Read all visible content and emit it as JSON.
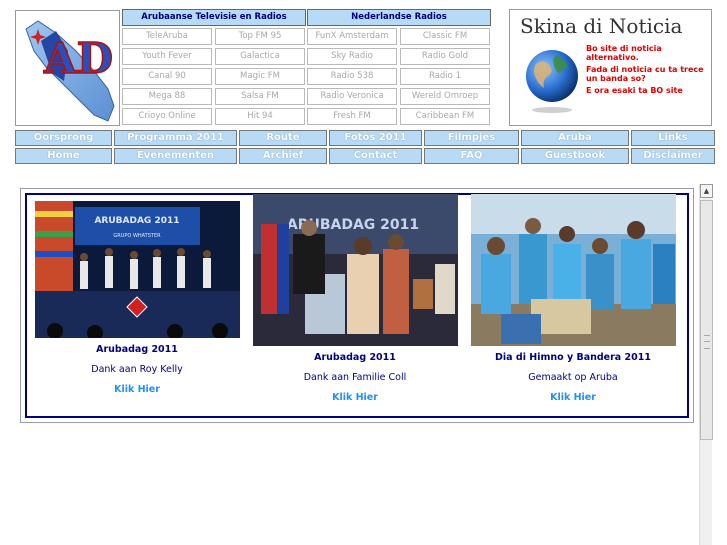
{
  "logo": {
    "text": "AD"
  },
  "radio": {
    "left_header": "Arubaanse Televisie en Radios",
    "right_header": "Nederlandse Radios",
    "left_items": [
      "TeleAruba",
      "Top FM 95",
      "Youth Fever",
      "Galactica",
      "Canal 90",
      "Magic FM",
      "Mega 88",
      "Salsa FM",
      "Crioyo Online",
      "Hit 94"
    ],
    "right_items": [
      "FunX Amsterdam",
      "Classic FM",
      "Sky Radio",
      "Radio Gold",
      "Radio 538",
      "Radio 1",
      "Radio Veronica",
      "Wereld Omroep",
      "Fresh FM",
      "Caribbean FM"
    ]
  },
  "news": {
    "title": "Skina di Noticia",
    "line1": "Bo site di noticia alternativo.",
    "line2": "Fada di noticia cu ta trece un banda so?",
    "line3": "E ora esaki ta BO site"
  },
  "nav": {
    "row1": [
      "Oorsprong",
      "Programma 2011",
      "Route",
      "Fotos 2011",
      "Filmpjes",
      "Aruba",
      "Links"
    ],
    "row2": [
      "Home",
      "Evenementen",
      "Archief",
      "Contact",
      "FAQ",
      "Guestbook",
      "Disclaimer"
    ]
  },
  "gallery": [
    {
      "title": "Arubadag 2011",
      "subtitle": "Dank aan Roy Kelly",
      "link": "Klik Hier",
      "banner": "ARUBADAG 2011",
      "banner2": "GRUPO WHATSTER"
    },
    {
      "title": "Arubadag 2011",
      "subtitle": "Dank aan Familie Coll",
      "link": "Klik Hier",
      "banner": "ARUBADAG 2011"
    },
    {
      "title": "Dia di Himno y Bandera 2011",
      "subtitle": "Gemaakt op Aruba",
      "link": "Klik Hier"
    }
  ],
  "colors": {
    "nav_bg": "#b7daf6",
    "header_text": "#000080",
    "link": "#1e90ff",
    "news_red": "#e00000"
  },
  "icons": {
    "logo": "aruba-ad-logo",
    "globe": "earth-globe-icon",
    "scroll_up": "scroll-up-arrow-icon"
  }
}
